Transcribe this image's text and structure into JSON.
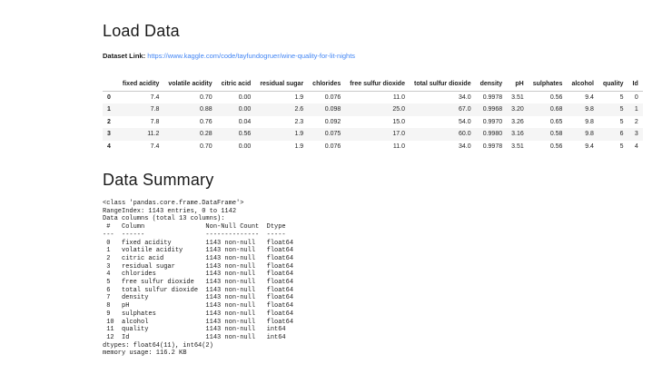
{
  "colors": {
    "link_blue": "#4285f4",
    "row_stripe": "#f5f5f5",
    "header_border": "#c9c9c9",
    "text": "#1c1c1c"
  },
  "load_data_section": {
    "title": "Load Data",
    "dataset_link_label": "Dataset Link:",
    "dataset_link_text": "https://www.kaggle.com/code/tayfundogruer/wine-quality-for-lit-nights"
  },
  "dataframe_table": {
    "columns": [
      "fixed acidity",
      "volatile acidity",
      "citric acid",
      "residual sugar",
      "chlorides",
      "free sulfur dioxide",
      "total sulfur dioxide",
      "density",
      "pH",
      "sulphates",
      "alcohol",
      "quality",
      "Id"
    ],
    "rows": [
      {
        "index": "0",
        "values": [
          "7.4",
          "0.70",
          "0.00",
          "1.9",
          "0.076",
          "11.0",
          "34.0",
          "0.9978",
          "3.51",
          "0.56",
          "9.4",
          "5",
          "0"
        ]
      },
      {
        "index": "1",
        "values": [
          "7.8",
          "0.88",
          "0.00",
          "2.6",
          "0.098",
          "25.0",
          "67.0",
          "0.9968",
          "3.20",
          "0.68",
          "9.8",
          "5",
          "1"
        ]
      },
      {
        "index": "2",
        "values": [
          "7.8",
          "0.76",
          "0.04",
          "2.3",
          "0.092",
          "15.0",
          "54.0",
          "0.9970",
          "3.26",
          "0.65",
          "9.8",
          "5",
          "2"
        ]
      },
      {
        "index": "3",
        "values": [
          "11.2",
          "0.28",
          "0.56",
          "1.9",
          "0.075",
          "17.0",
          "60.0",
          "0.9980",
          "3.16",
          "0.58",
          "9.8",
          "6",
          "3"
        ]
      },
      {
        "index": "4",
        "values": [
          "7.4",
          "0.70",
          "0.00",
          "1.9",
          "0.076",
          "11.0",
          "34.0",
          "0.9978",
          "3.51",
          "0.56",
          "9.4",
          "5",
          "4"
        ]
      }
    ]
  },
  "data_summary_section": {
    "title": "Data Summary",
    "info_lines": [
      "<class 'pandas.core.frame.DataFrame'>",
      "RangeIndex: 1143 entries, 0 to 1142",
      "Data columns (total 13 columns):",
      " #   Column                Non-Null Count  Dtype  ",
      "---  ------                --------------  -----  ",
      " 0   fixed acidity         1143 non-null   float64",
      " 1   volatile acidity      1143 non-null   float64",
      " 2   citric acid           1143 non-null   float64",
      " 3   residual sugar        1143 non-null   float64",
      " 4   chlorides             1143 non-null   float64",
      " 5   free sulfur dioxide   1143 non-null   float64",
      " 6   total sulfur dioxide  1143 non-null   float64",
      " 7   density               1143 non-null   float64",
      " 8   pH                    1143 non-null   float64",
      " 9   sulphates             1143 non-null   float64",
      " 10  alcohol               1143 non-null   float64",
      " 11  quality               1143 non-null   int64  ",
      " 12  Id                    1143 non-null   int64  ",
      "dtypes: float64(11), int64(2)",
      "memory usage: 116.2 KB"
    ]
  }
}
